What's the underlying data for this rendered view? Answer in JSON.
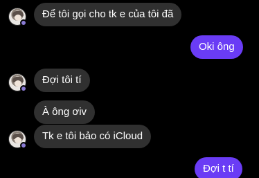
{
  "conversation": {
    "messages": [
      {
        "side": "incoming",
        "text": "Để tôi gọi cho tk e của tôi đã",
        "avatar": true
      },
      {
        "side": "outgoing",
        "text": "Oki ông"
      },
      {
        "side": "incoming",
        "text": "Đợi tôi tí",
        "avatar": true
      },
      {
        "side": "incoming",
        "text": "À ông ơiv",
        "avatar": false
      },
      {
        "side": "incoming",
        "text": "Tk e tôi bảo có iCloud",
        "avatar": true
      },
      {
        "side": "outgoing",
        "text": "Đợi t tí"
      }
    ]
  },
  "colors": {
    "background": "#000000",
    "incoming_bubble": "#303030",
    "outgoing_bubble": "#6a3cf5",
    "text": "#ffffff"
  }
}
